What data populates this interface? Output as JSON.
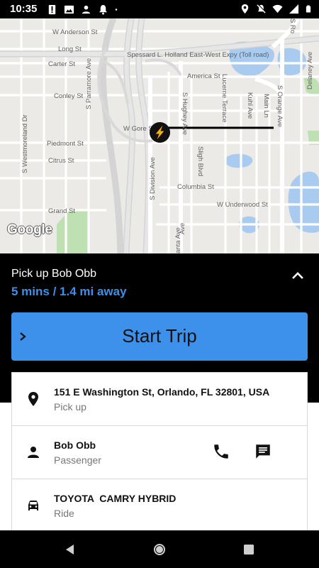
{
  "status_bar": {
    "time": "10:35",
    "left_icons": [
      "alert-icon",
      "image-icon",
      "person-icon",
      "bell-icon",
      "dot-icon"
    ],
    "right_icons": [
      "location-icon",
      "notifications-off-icon",
      "wifi-icon",
      "signal-icon",
      "battery-icon"
    ]
  },
  "map": {
    "logo": "Google",
    "street_labels": {
      "w_anderson": "W Anderson St",
      "long": "Long St",
      "spessard": "Spessard L. Holland East-West Expy (Toll road)",
      "carter": "Carter St",
      "america": "America St",
      "conley": "Conley St",
      "w_gore": "W Gore St",
      "piedmont": "Piedmont St",
      "citrus": "Citrus St",
      "columbia": "Columbia St",
      "w_underwood": "W Underwood St",
      "grand": "Grand St",
      "s_parramore": "S Parramore Ave",
      "s_westmoreland": "S Westmoreland Dr",
      "s_division": "S Division Ave",
      "s_hughey": "S Hughey Ave",
      "sligh": "Sligh Blvd",
      "lucerne": "Lucerne Terrace",
      "kuhl": "Kuhl Ave",
      "main": "Main Ln",
      "s_orange": "S Orange Ave",
      "delaney": "Delaney Ave",
      "s_rosalind": "S Ro",
      "santa": "anta Ave",
      "s_ave": "Ave"
    },
    "vehicle_marker": "navigation-arrow-icon"
  },
  "trip": {
    "title": "Pick up Bob Obb",
    "eta": "5 mins / 1.4 mi away",
    "start_button": "Start Trip",
    "collapse_icon": "chevron-up-icon"
  },
  "details": {
    "address": {
      "line1": "151 E Washington St, Orlando, FL 32801, USA",
      "line2": "Pick up",
      "icon": "location-pin-icon"
    },
    "passenger": {
      "line1": "Bob Obb",
      "line2": "Passenger",
      "icon": "person-icon",
      "actions": [
        "phone-icon",
        "message-icon"
      ]
    },
    "ride": {
      "line1": "TOYOTA  CAMRY HYBRID",
      "line2": "Ride",
      "icon": "car-icon"
    }
  },
  "nav_bar": {
    "buttons": [
      "back-button",
      "home-button",
      "recents-button"
    ]
  },
  "colors": {
    "accent": "#3e91ea",
    "eta_text": "#3d8fe8",
    "panel": "#000000",
    "marker": "#f5b400"
  }
}
